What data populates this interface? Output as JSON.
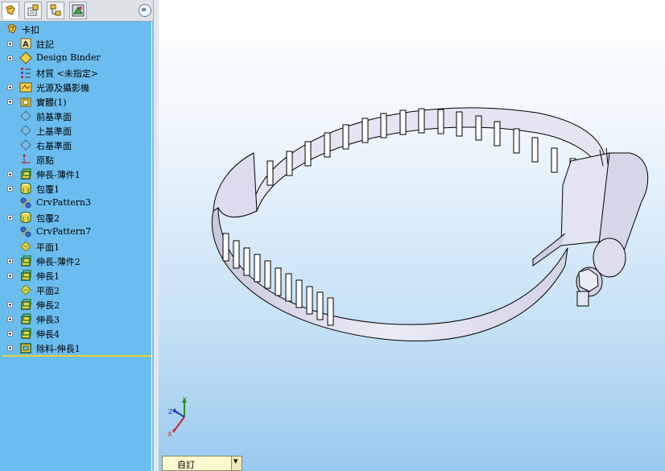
{
  "tabs": [
    {
      "icon": "feature-manager-icon"
    },
    {
      "icon": "property-manager-icon"
    },
    {
      "icon": "configuration-manager-icon"
    },
    {
      "icon": "display-manager-icon"
    }
  ],
  "expand_glyph": "»",
  "tree": {
    "root": {
      "label": "卡扣",
      "icon": "part-icon"
    },
    "items": [
      {
        "label": "註記",
        "icon": "annotations-icon",
        "expandable": true
      },
      {
        "label": "Design Binder",
        "icon": "design-binder-icon",
        "expandable": true
      },
      {
        "label": "材質 <未指定>",
        "icon": "material-icon",
        "expandable": false
      },
      {
        "label": "光源及攝影機",
        "icon": "lights-cameras-icon",
        "expandable": true
      },
      {
        "label": "實體(1)",
        "icon": "solid-bodies-icon",
        "expandable": true
      },
      {
        "label": "前基準面",
        "icon": "plane-icon",
        "expandable": false
      },
      {
        "label": "上基準面",
        "icon": "plane-icon",
        "expandable": false
      },
      {
        "label": "右基準面",
        "icon": "plane-icon",
        "expandable": false
      },
      {
        "label": "原點",
        "icon": "origin-icon",
        "expandable": false
      },
      {
        "label": "伸長-薄件1",
        "icon": "extrude-icon",
        "expandable": true
      },
      {
        "label": "包覆1",
        "icon": "wrap-icon",
        "expandable": true
      },
      {
        "label": "CrvPattern3",
        "icon": "curve-pattern-icon",
        "expandable": false
      },
      {
        "label": "包覆2",
        "icon": "wrap-icon",
        "expandable": true
      },
      {
        "label": "CrvPattern7",
        "icon": "curve-pattern-icon",
        "expandable": false
      },
      {
        "label": "平面1",
        "icon": "ref-plane-icon",
        "expandable": false
      },
      {
        "label": "伸長-薄件2",
        "icon": "extrude-icon",
        "expandable": true
      },
      {
        "label": "伸長1",
        "icon": "extrude-icon",
        "expandable": true
      },
      {
        "label": "平面2",
        "icon": "ref-plane-icon",
        "expandable": false
      },
      {
        "label": "伸長2",
        "icon": "extrude-icon",
        "expandable": true
      },
      {
        "label": "伸長3",
        "icon": "extrude-icon",
        "expandable": true
      },
      {
        "label": "伸長4",
        "icon": "extrude-icon",
        "expandable": true
      },
      {
        "label": "除料-伸長1",
        "icon": "cut-extrude-icon",
        "expandable": true
      }
    ]
  },
  "triad": {
    "x": "X",
    "y": "Y",
    "z": "Z"
  },
  "configuration": {
    "label": "自訂",
    "dropdown_glyph": "▼"
  },
  "colors": {
    "tree_background": "#6bbdf0",
    "tree_separator": "#e5d13c",
    "model_shade": "#d8d8ec",
    "model_edge": "#000000"
  }
}
